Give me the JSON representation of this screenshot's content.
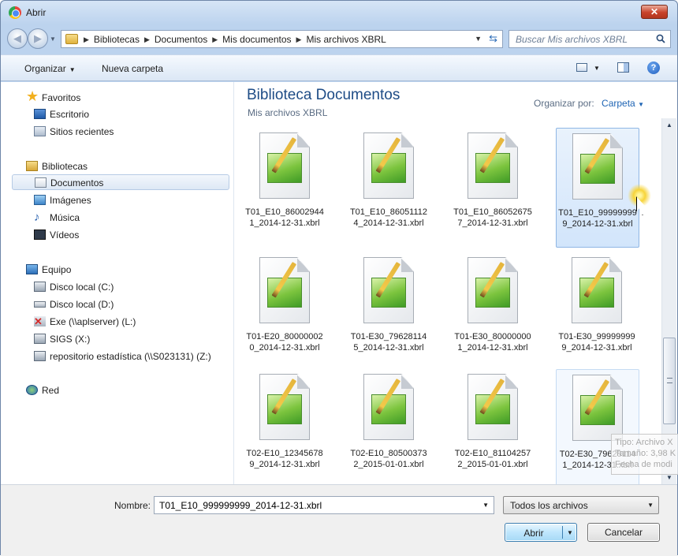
{
  "window": {
    "title": "Abrir",
    "close_label": "✕"
  },
  "address": {
    "crumbs": [
      "Bibliotecas",
      "Documentos",
      "Mis documentos",
      "Mis archivos XBRL"
    ]
  },
  "search": {
    "placeholder": "Buscar Mis archivos XBRL"
  },
  "toolbar": {
    "organize_label": "Organizar",
    "new_folder_label": "Nueva carpeta"
  },
  "sidebar": {
    "favorites": {
      "label": "Favoritos",
      "items": [
        "Escritorio",
        "Sitios recientes"
      ]
    },
    "libraries": {
      "label": "Bibliotecas",
      "items": [
        "Documentos",
        "Imágenes",
        "Música",
        "Vídeos"
      ]
    },
    "computer": {
      "label": "Equipo",
      "items": [
        "Disco local (C:)",
        "Disco local (D:)",
        "Exe (\\\\aplserver) (L:)",
        "SIGS (X:)",
        "repositorio estadística (\\\\S023131) (Z:)"
      ]
    },
    "network": {
      "label": "Red"
    },
    "selected": "Documentos"
  },
  "content": {
    "library_title": "Biblioteca Documentos",
    "library_subtitle": "Mis archivos XBRL",
    "arrange_label": "Organizar por:",
    "arrange_value": "Carpeta",
    "files": [
      {
        "name": "T01_E10_860029441_2014-12-31.xbrl",
        "state": "normal"
      },
      {
        "name": "T01_E10_860511124_2014-12-31.xbrl",
        "state": "normal"
      },
      {
        "name": "T01_E10_860526757_2014-12-31.xbrl",
        "state": "normal"
      },
      {
        "name": "T01_E10_999999999_2014-12-31.xbrl",
        "state": "selected"
      },
      {
        "name": "T01-E20_800000020_2014-12-31.xbrl",
        "state": "normal"
      },
      {
        "name": "T01-E30_796281145_2014-12-31.xbrl",
        "state": "normal"
      },
      {
        "name": "T01-E30_800000001_2014-12-31.xbrl",
        "state": "normal"
      },
      {
        "name": "T01-E30_999999999_2014-12-31.xbrl",
        "state": "normal"
      },
      {
        "name": "T02-E10_123456789_2014-12-31.xbrl",
        "state": "normal"
      },
      {
        "name": "T02-E10_805003732_2015-01-01.xbrl",
        "state": "normal"
      },
      {
        "name": "T02-E10_811042572_2015-01-01.xbrl",
        "state": "normal"
      },
      {
        "name": "T02-E30_796281141_2014-12-31.xbrl",
        "state": "hover"
      }
    ]
  },
  "tooltip": {
    "lines": [
      "Tipo: Archivo X",
      "Tamaño: 3,98 K",
      "Fecha de modi"
    ]
  },
  "footer": {
    "name_label": "Nombre:",
    "name_value": "T01_E10_999999999_2014-12-31.xbrl",
    "filter_value": "Todos los archivos",
    "open_label": "Abrir",
    "cancel_label": "Cancelar"
  }
}
